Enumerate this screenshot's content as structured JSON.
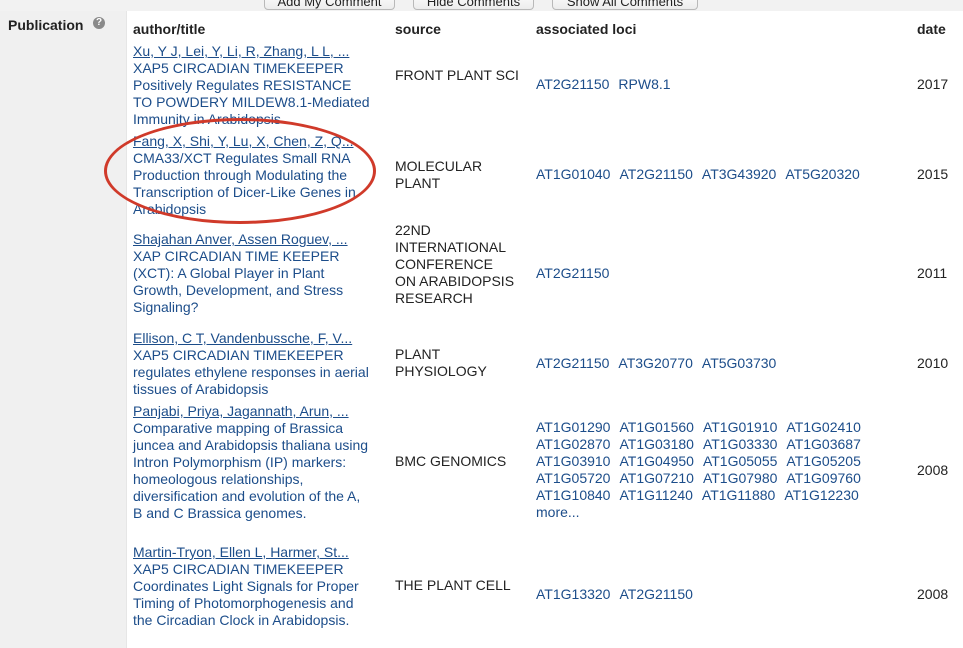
{
  "toolbar": {
    "add_comment": "Add My Comment",
    "hide_comments": "Hide Comments",
    "show_all_comments": "Show All Comments"
  },
  "section": {
    "label": "Publication",
    "help_icon": "?"
  },
  "columns": {
    "author_title": "author/title",
    "source": "source",
    "loci": "associated loci",
    "date": "date"
  },
  "publications": [
    {
      "authors": "Xu, Y J, Lei, Y, Li, R, Zhang, L L, ...",
      "title": "XAP5 CIRCADIAN TIMEKEEPER Positively Regulates RESISTANCE TO POWDERY MILDEW8.1-Mediated Immunity in Arabidopsis",
      "source": "FRONT PLANT SCI",
      "loci": [
        "AT2G21150",
        "RPW8.1"
      ],
      "date": "2017"
    },
    {
      "authors": "Fang, X, Shi, Y, Lu, X, Chen, Z, Q...",
      "title": "CMA33/XCT Regulates Small RNA Production through Modulating the Transcription of Dicer-Like Genes in Arabidopsis",
      "source": "MOLECULAR PLANT",
      "loci": [
        "AT1G01040",
        "AT2G21150",
        "AT3G43920",
        "AT5G20320"
      ],
      "date": "2015"
    },
    {
      "authors": "Shajahan Anver, Assen Roguev, ...",
      "title": "XAP CIRCADIAN TIME KEEPER (XCT): A Global Player in Plant Growth, Development, and Stress Signaling?",
      "source": "22ND INTERNATIONAL CONFERENCE ON ARABIDOPSIS RESEARCH",
      "loci": [
        "AT2G21150"
      ],
      "date": "2011"
    },
    {
      "authors": "Ellison, C T, Vandenbussche, F, V...",
      "title": "XAP5 CIRCADIAN TIMEKEEPER regulates ethylene responses in aerial tissues of Arabidopsis",
      "source": "PLANT PHYSIOLOGY",
      "loci": [
        "AT2G21150",
        "AT3G20770",
        "AT5G03730"
      ],
      "date": "2010"
    },
    {
      "authors": "Panjabi, Priya, Jagannath, Arun, ...",
      "title": "Comparative mapping of Brassica juncea and Arabidopsis thaliana using Intron Polymorphism (IP) markers: homeologous relationships, diversification and evolution of the A, B and C Brassica genomes.",
      "source": "BMC GENOMICS",
      "loci": [
        "AT1G01290",
        "AT1G01560",
        "AT1G01910",
        "AT1G02410",
        "AT1G02870",
        "AT1G03180",
        "AT1G03330",
        "AT1G03687",
        "AT1G03910",
        "AT1G04950",
        "AT1G05055",
        "AT1G05205",
        "AT1G05720",
        "AT1G07210",
        "AT1G07980",
        "AT1G09760",
        "AT1G10840",
        "AT1G11240",
        "AT1G11880",
        "AT1G12230"
      ],
      "more": "more...",
      "date": "2008"
    },
    {
      "authors": "Martin-Tryon, Ellen L, Harmer, St...",
      "title": "XAP5 CIRCADIAN TIMEKEEPER Coordinates Light Signals for Proper Timing of Photomorphogenesis and the Circadian Clock in Arabidopsis.",
      "source": "THE PLANT CELL",
      "loci": [
        "AT1G13320",
        "AT2G21150"
      ],
      "date": "2008"
    }
  ]
}
